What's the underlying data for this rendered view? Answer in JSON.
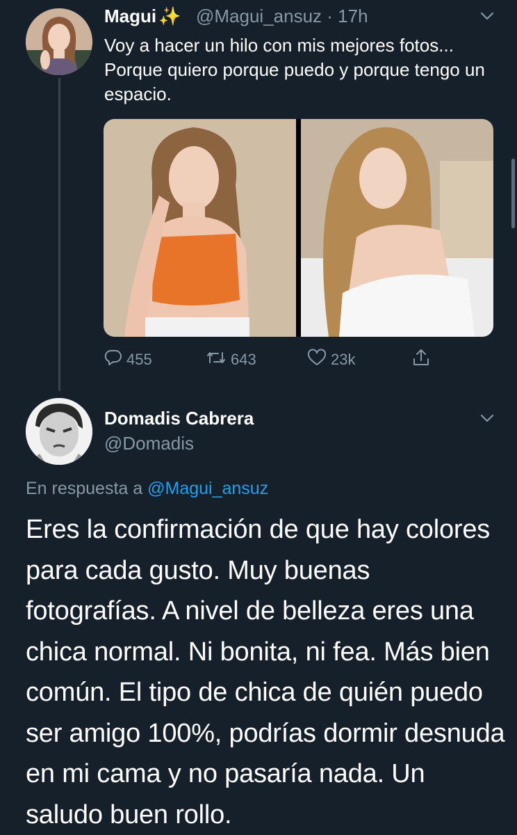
{
  "tweet": {
    "author_name": "Magui",
    "author_emoji": "✨",
    "handle_time": "@Magui_ansuz · 17h",
    "text": "Voy a hacer un hilo con mis mejores fotos... Porque quiero porque puedo y porque tengo un espacio.",
    "actions": {
      "replies": "455",
      "retweets": "643",
      "likes": "23k"
    }
  },
  "reply": {
    "author_name": "Domadis Cabrera",
    "handle": "@Domadis",
    "in_reply_prefix": "En respuesta a ",
    "in_reply_handle": "@Magui_ansuz",
    "text": "Eres la confirmación de que hay colores para cada gusto. Muy buenas fotografías. A nivel de belleza eres una chica normal. Ni bonita, ni fea. Más bien común. El tipo de chica de quién puedo ser amigo 100%, podrías dormir desnuda en mi cama y no pasaría nada. Un saludo buen rollo."
  },
  "icons": {
    "reply": "reply-bubble-icon",
    "retweet": "retweet-icon",
    "like": "heart-icon",
    "share": "share-icon",
    "more": "chevron-down-icon"
  },
  "colors": {
    "background": "#15202b",
    "secondary_text": "#8899a6",
    "link": "#1da1f2",
    "sparkle": "#f5c518"
  }
}
